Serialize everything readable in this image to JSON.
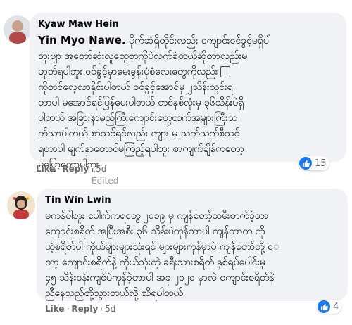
{
  "comments": [
    {
      "author": "Kyaw Maw Hein",
      "mention": "Yin Myo Nawe.",
      "lines": [
        "ပိုက်ဆံရှိတိုင်းလည်း ကျောင်းဝင်ခွင့်မရှိပါ",
        "ဘူးဗျာ အတော်ဆုံးလူတွေတကိုပဲလက်ခံတယ်ဆိုတာလည်းမ",
        "ဟုတ်ရပါဘူး ဝင်ခွင့်မှာမေးခွန်းပုံစံလေးတွေကိုလည်း",
        "ကိုတင်လေ့လာနိုင်းပါတယ် ဝင်ခွင့်အောင်မှ ၂သိန်းသွင်းရ",
        "တာပါ မအောင်ရင်ပြန်ပေးပါတယ် တစ်နှစ်လုံးမှ ၃၆သိန်းပဲရှိ",
        "ပါတယ် အခြားနာမည်ကြီးကျောင်းတွေထက်အများကြီးသ",
        "က်သာပါတယ် စာသင်ရင်လည်း ကျား မ သက်သက်စီသင်",
        "ရတာပါ မျက်နှာတောင်မကြည့်ရပါဘူး စာကျက်ချိန်ကတော့",
        "မပြောတော့ပါဘူး"
      ],
      "actions": {
        "like": "Like",
        "reply": "Reply",
        "age": "5d"
      },
      "reaction_count": "15"
    },
    {
      "author": "Tin Win Lwin",
      "lines": [
        "မကန်ပါဘူး ပေါက်ကရတွေ ၂၀၁၉ မှ ကျန်တော့်သမီးတက်ခဲ့တာ",
        "ကျောင်းစရိတ် အပြီးအစီး ၃၆ သိန်းပဲကုန်တာပါ ကျန်တာက ကို",
        "ယ့်စရိတ်ပါ ကိုယ်များများသုံးရင် များများကုန်မှာပဲ ကျန်တော်တို့ ‌ေ",
        "တာ့ ကျောင်းစရိတ်နဲ့ ကိုယ်သုံးတဲ့ ခရီးသားစရိတ် နှစ်ရပ်ပေါင်းမှ",
        "၄၅ သိန်းဝန်းကျင်ပဲကုန်ခဲ့တာပါ အခု ၂၀၂၀ မှာလဲ ကျောင်းစရိတ်နဲ",
        "ညီနေသည်တို့သွားတယ်လို့ သိရပါတယ်"
      ],
      "actions": {
        "like": "Like",
        "reply": "Reply",
        "age": "5d",
        "edited": "Edited"
      },
      "reaction_count": "4"
    }
  ]
}
